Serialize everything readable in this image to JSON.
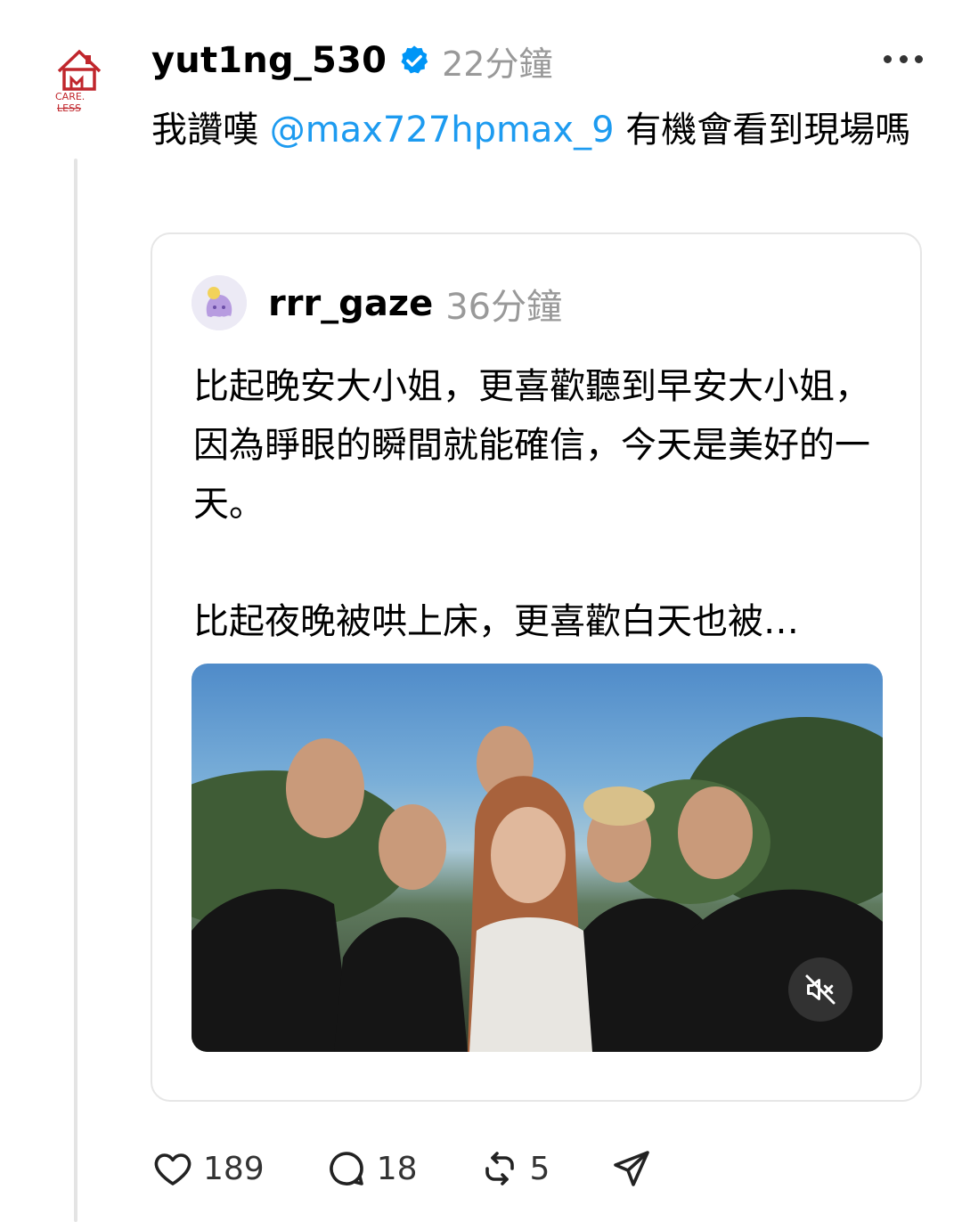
{
  "post": {
    "username": "yut1ng_530",
    "time": "22分鐘",
    "text_before": "我讚嘆 ",
    "mention": "@max727hpmax_9",
    "text_after": " 有機會看到現場嗎",
    "avatar_logo_text": "CARE LESS"
  },
  "quote": {
    "username": "rrr_gaze",
    "time": "36分鐘",
    "text": "比起晚安大小姐，更喜歡聽到早安大小姐，因為睜眼的瞬間就能確信，今天是美好的一天。\n\n比起夜晚被哄上床，更喜歡白天也被…"
  },
  "actions": {
    "likes": "189",
    "comments": "18",
    "reposts": "5"
  },
  "colors": {
    "mention": "#1d9bf0",
    "verified": "#0095f6",
    "muted_text": "#999999"
  },
  "icons": [
    "more-icon",
    "verified-icon",
    "heart-icon",
    "comment-icon",
    "repost-icon",
    "share-icon",
    "mute-icon"
  ]
}
